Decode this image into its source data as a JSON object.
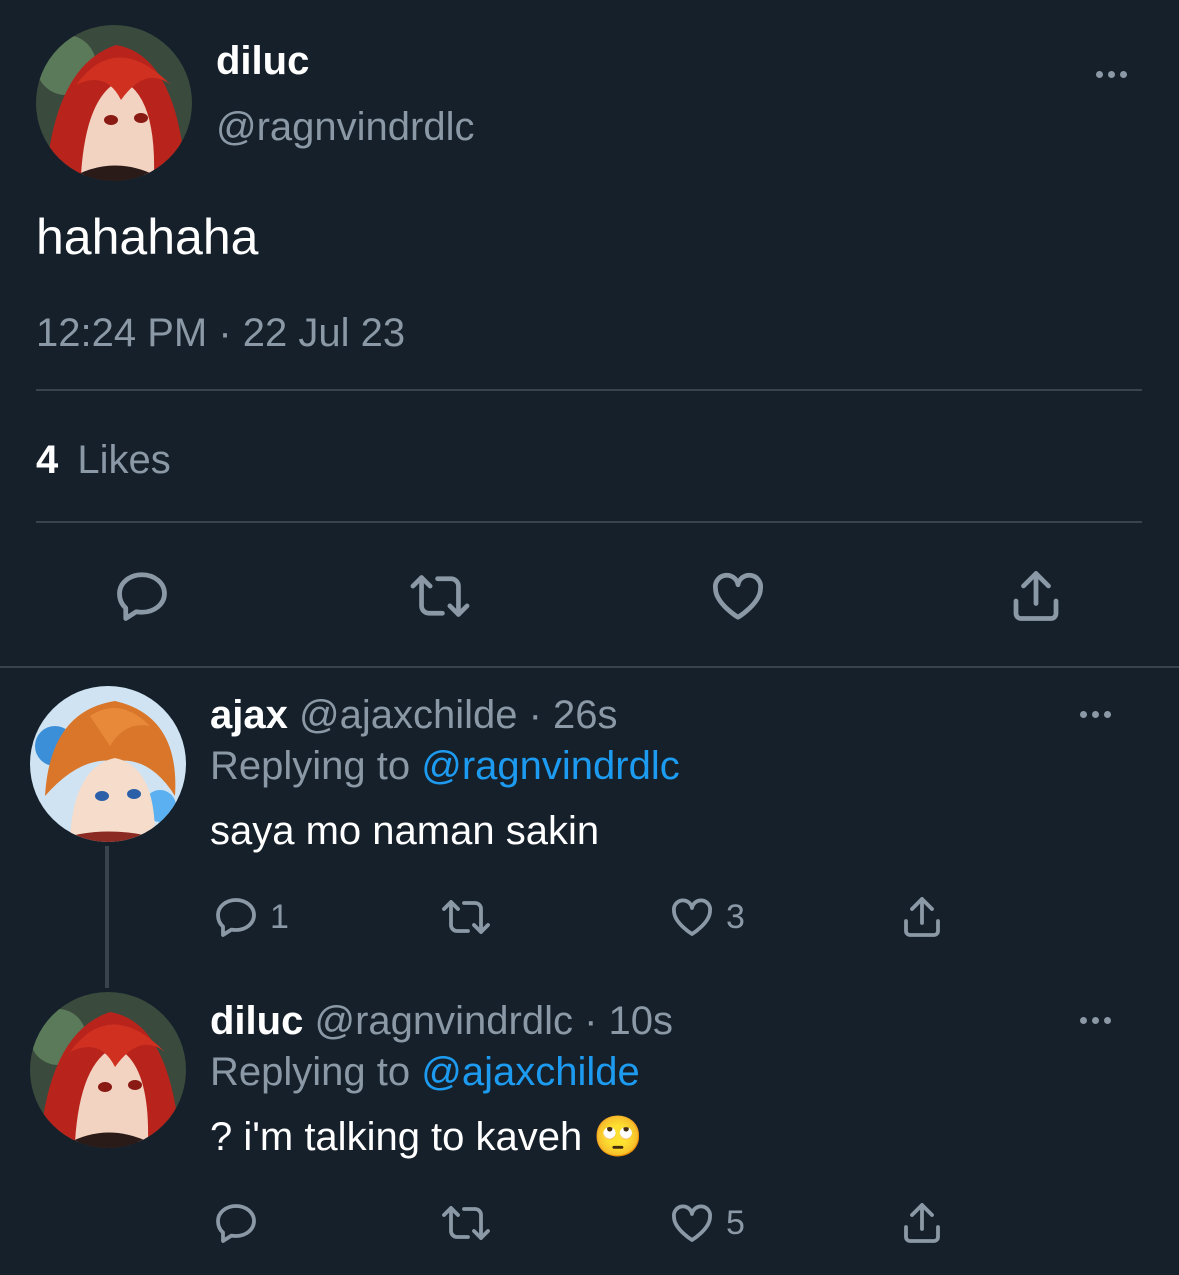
{
  "main_tweet": {
    "display_name": "diluc",
    "handle": "@ragnvindrdlc",
    "text": "hahahaha",
    "timestamp": "12:24 PM · 22 Jul 23",
    "likes_count": "4",
    "likes_label": "Likes"
  },
  "replies": [
    {
      "display_name": "ajax",
      "handle": "@ajaxchilde",
      "age": "26s",
      "replying_prefix": "Replying to",
      "replying_to": "@ragnvindrdlc",
      "text": "saya mo naman sakin",
      "reply_count": "1",
      "retweet_count": "",
      "like_count": "3"
    },
    {
      "display_name": "diluc",
      "handle": "@ragnvindrdlc",
      "age": "10s",
      "replying_prefix": "Replying to",
      "replying_to": "@ajaxchilde",
      "text": "? i'm talking to kaveh 🙄",
      "reply_count": "",
      "retweet_count": "",
      "like_count": "5"
    }
  ],
  "icons": [
    "reply-icon",
    "retweet-icon",
    "like-icon",
    "share-icon",
    "more-icon"
  ],
  "colors": {
    "background": "#15202b",
    "muted_text": "#8b98a5",
    "link": "#1d9bf0",
    "divider": "#38444d"
  }
}
